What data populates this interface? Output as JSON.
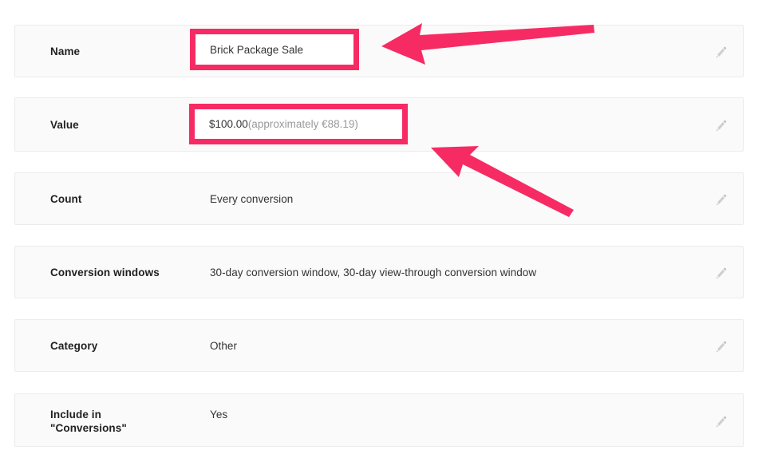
{
  "page": {
    "background_color": "#ffffff",
    "row_background_color": "#fafafa",
    "row_border_color": "#ececec",
    "label_color": "#212121",
    "value_color": "#333333",
    "muted_value_color": "#9a9a9a",
    "icon_color": "#c7c7c7",
    "annotation_color": "#f72b63"
  },
  "settings_rows": [
    {
      "label": "Name",
      "value": "Brick Package Sale",
      "value_suffix": "",
      "edit_icon": "pencil-icon",
      "highlighted": true
    },
    {
      "label": "Value",
      "value": "$100.00",
      "value_suffix": " (approximately €88.19)",
      "edit_icon": "pencil-icon",
      "highlighted": true
    },
    {
      "label": "Count",
      "value": "Every conversion",
      "value_suffix": "",
      "edit_icon": "pencil-icon",
      "highlighted": false
    },
    {
      "label": "Conversion windows",
      "value": "30-day conversion window, 30-day view-through conversion window",
      "value_suffix": "",
      "edit_icon": "pencil-icon",
      "highlighted": false
    },
    {
      "label": "Category",
      "value": "Other",
      "value_suffix": "",
      "edit_icon": "pencil-icon",
      "highlighted": false
    },
    {
      "label": "Include in\n\"Conversions\"",
      "value": "Yes",
      "value_suffix": "",
      "edit_icon": "pencil-icon",
      "highlighted": false
    }
  ],
  "annotations": {
    "color": "#f72b63",
    "highlight_boxes": [
      {
        "target": "name-value",
        "text": "Brick Package Sale",
        "text_suffix": ""
      },
      {
        "target": "value-value",
        "text": "$100.00",
        "text_suffix": " (approximately €88.19)"
      }
    ],
    "arrows": [
      {
        "name": "arrow-to-name-field",
        "direction": "left"
      },
      {
        "name": "arrow-to-value-field",
        "direction": "up-left"
      }
    ]
  }
}
